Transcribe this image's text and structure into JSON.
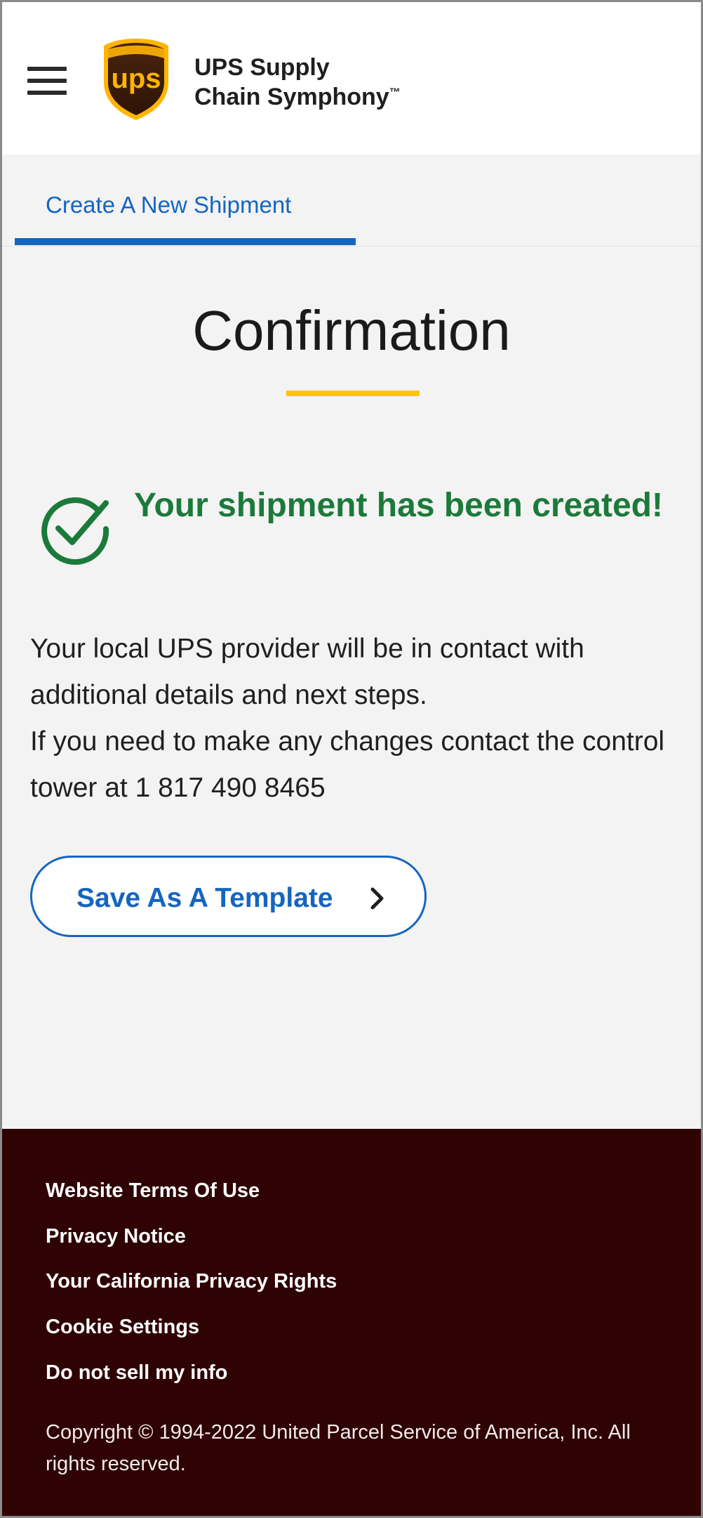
{
  "header": {
    "brand_line1": "UPS Supply",
    "brand_line2": "Chain Symphony",
    "brand_tm": "™",
    "logo_text": "ups"
  },
  "tabs": [
    {
      "label": "Create A New Shipment",
      "active": true
    }
  ],
  "main": {
    "title": "Confirmation",
    "success_message": "Your shipment has been created!",
    "body_lines": [
      "Your local UPS provider will be in contact with additional details and next steps.",
      "If you need to make any changes contact the control tower at 1 817 490 8465"
    ],
    "template_button_label": "Save As A Template"
  },
  "footer": {
    "links": [
      "Website Terms Of Use",
      "Privacy Notice",
      "Your California Privacy Rights",
      "Cookie Settings",
      "Do not sell my info"
    ],
    "copyright": "Copyright © 1994-2022 United Parcel Service of America, Inc. All rights reserved."
  },
  "colors": {
    "accent_blue": "#1565c0",
    "success_green": "#1b7a3a",
    "title_accent_yellow": "#ffc400",
    "footer_brown": "#2f0303",
    "ups_brown": "#3b1a08",
    "ups_gold": "#ffb500"
  },
  "icons": {
    "menu": "hamburger-menu-icon",
    "success": "check-circle-icon",
    "button": "chevron-right-icon"
  }
}
